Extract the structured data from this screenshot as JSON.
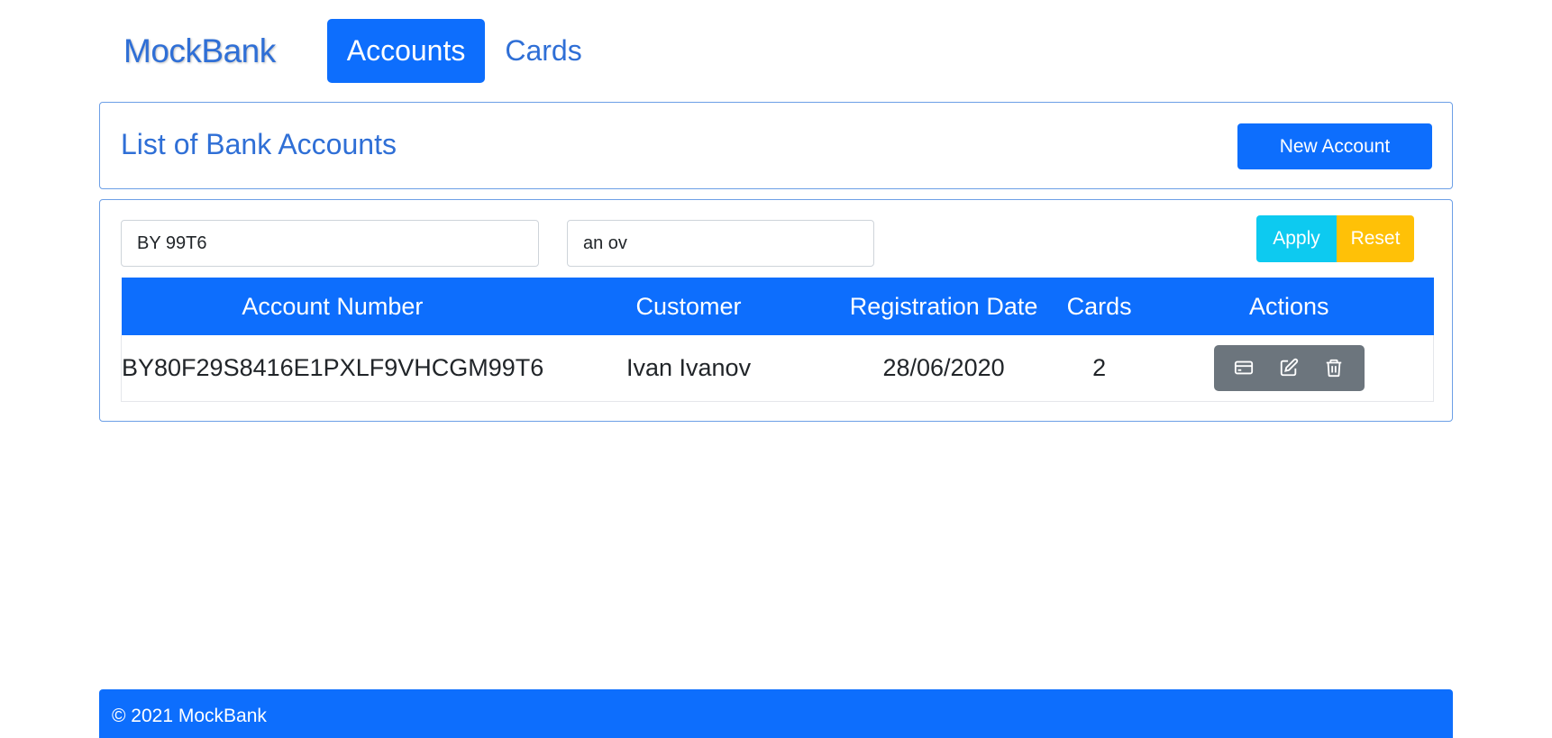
{
  "nav": {
    "brand": "MockBank",
    "links": [
      {
        "label": "Accounts",
        "active": true
      },
      {
        "label": "Cards",
        "active": false
      }
    ]
  },
  "header": {
    "title": "List of Bank Accounts",
    "new_button": "New Account"
  },
  "filters": {
    "account_value": "BY 99T6",
    "customer_value": "an ov",
    "apply_label": "Apply",
    "reset_label": "Reset"
  },
  "table": {
    "columns": [
      "Account Number",
      "Customer",
      "Registration Date",
      "Cards",
      "Actions"
    ],
    "rows": [
      {
        "account_number": "BY80F29S8416E1PXLF9VHCGM99T6",
        "customer": "Ivan Ivanov",
        "registration_date": "28/06/2020",
        "cards": "2",
        "actions": [
          "credit-card-icon",
          "edit-icon",
          "trash-icon"
        ]
      }
    ]
  },
  "footer": {
    "text": "© 2021 MockBank"
  },
  "colors": {
    "primary": "#0d6efd",
    "info": "#0dcaf0",
    "warning": "#ffc107",
    "secondary": "#6c757d",
    "brand_text": "#2f6fd6"
  }
}
